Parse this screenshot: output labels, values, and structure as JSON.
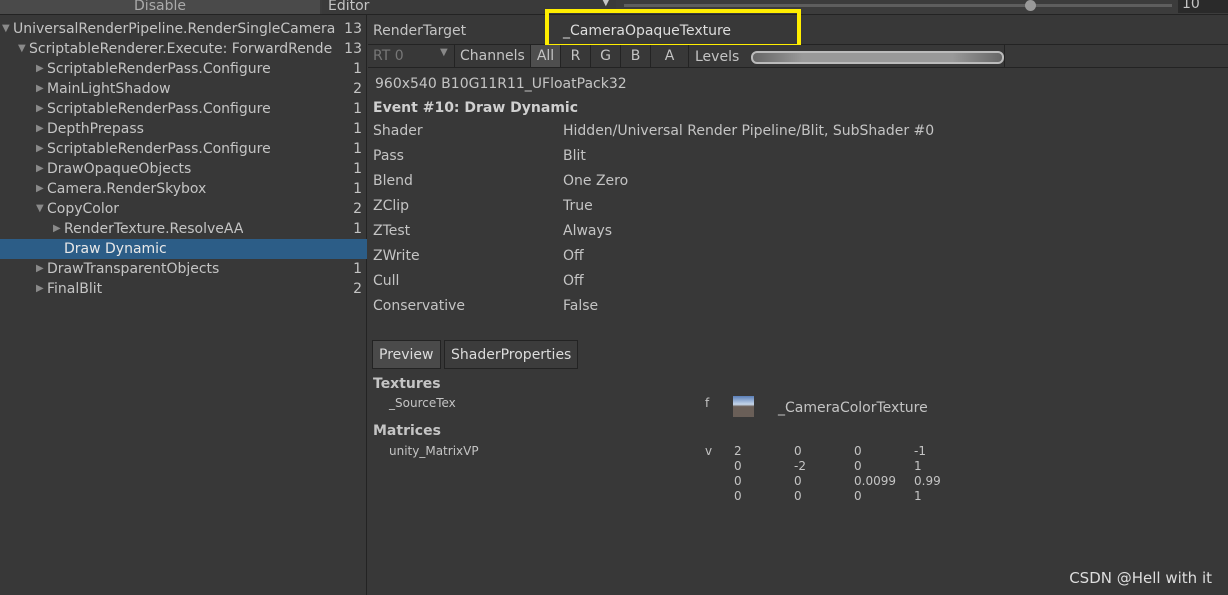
{
  "topbar": {
    "left_button": "Disable",
    "editor_label": "Editor",
    "slider_value": "10"
  },
  "tree": [
    {
      "label": "UniversalRenderPipeline.RenderSingleCamera",
      "count": "13",
      "depth": 0,
      "expanded": true
    },
    {
      "label": "ScriptableRenderer.Execute: ForwardRende",
      "count": "13",
      "depth": 1,
      "expanded": true
    },
    {
      "label": "ScriptableRenderPass.Configure",
      "count": "1",
      "depth": 2
    },
    {
      "label": "MainLightShadow",
      "count": "2",
      "depth": 2
    },
    {
      "label": "ScriptableRenderPass.Configure",
      "count": "1",
      "depth": 2
    },
    {
      "label": "DepthPrepass",
      "count": "1",
      "depth": 2
    },
    {
      "label": "ScriptableRenderPass.Configure",
      "count": "1",
      "depth": 2
    },
    {
      "label": "DrawOpaqueObjects",
      "count": "1",
      "depth": 2
    },
    {
      "label": "Camera.RenderSkybox",
      "count": "1",
      "depth": 2
    },
    {
      "label": "CopyColor",
      "count": "2",
      "depth": 2,
      "expanded": true
    },
    {
      "label": "RenderTexture.ResolveAA",
      "count": "1",
      "depth": 3
    },
    {
      "label": "Draw Dynamic",
      "count": "",
      "depth": 3,
      "selected": true,
      "leaf": true
    },
    {
      "label": "DrawTransparentObjects",
      "count": "1",
      "depth": 2
    },
    {
      "label": "FinalBlit",
      "count": "2",
      "depth": 2
    }
  ],
  "render_target": {
    "label": "RenderTarget",
    "value": "_CameraOpaqueTexture",
    "highlight_color": "#ffee00"
  },
  "channels": {
    "rt": "RT 0",
    "label": "Channels",
    "buttons": [
      "All",
      "R",
      "G",
      "B",
      "A"
    ],
    "levels_label": "Levels"
  },
  "format": "960x540 B10G11R11_UFloatPack32",
  "event_title": "Event #10: Draw Dynamic",
  "props": [
    {
      "k": "Shader",
      "v": "Hidden/Universal Render Pipeline/Blit, SubShader #0"
    },
    {
      "k": "Pass",
      "v": "Blit"
    },
    {
      "k": "Blend",
      "v": "One Zero"
    },
    {
      "k": "ZClip",
      "v": "True"
    },
    {
      "k": "ZTest",
      "v": "Always"
    },
    {
      "k": "ZWrite",
      "v": "Off"
    },
    {
      "k": "Cull",
      "v": "Off"
    },
    {
      "k": "Conservative",
      "v": "False"
    }
  ],
  "tabs": [
    "Preview",
    "ShaderProperties"
  ],
  "textures": {
    "title": "Textures",
    "name": "_SourceTex",
    "type": "f",
    "value": "_CameraColorTexture"
  },
  "matrices": {
    "title": "Matrices",
    "name": "unity_MatrixVP",
    "type": "v",
    "rows": [
      [
        "2",
        "0",
        "0",
        "-1"
      ],
      [
        "0",
        "-2",
        "0",
        "1"
      ],
      [
        "0",
        "0",
        "0.0099",
        "0.99"
      ],
      [
        "0",
        "0",
        "0",
        "1"
      ]
    ]
  },
  "watermark": "CSDN @Hell with it"
}
